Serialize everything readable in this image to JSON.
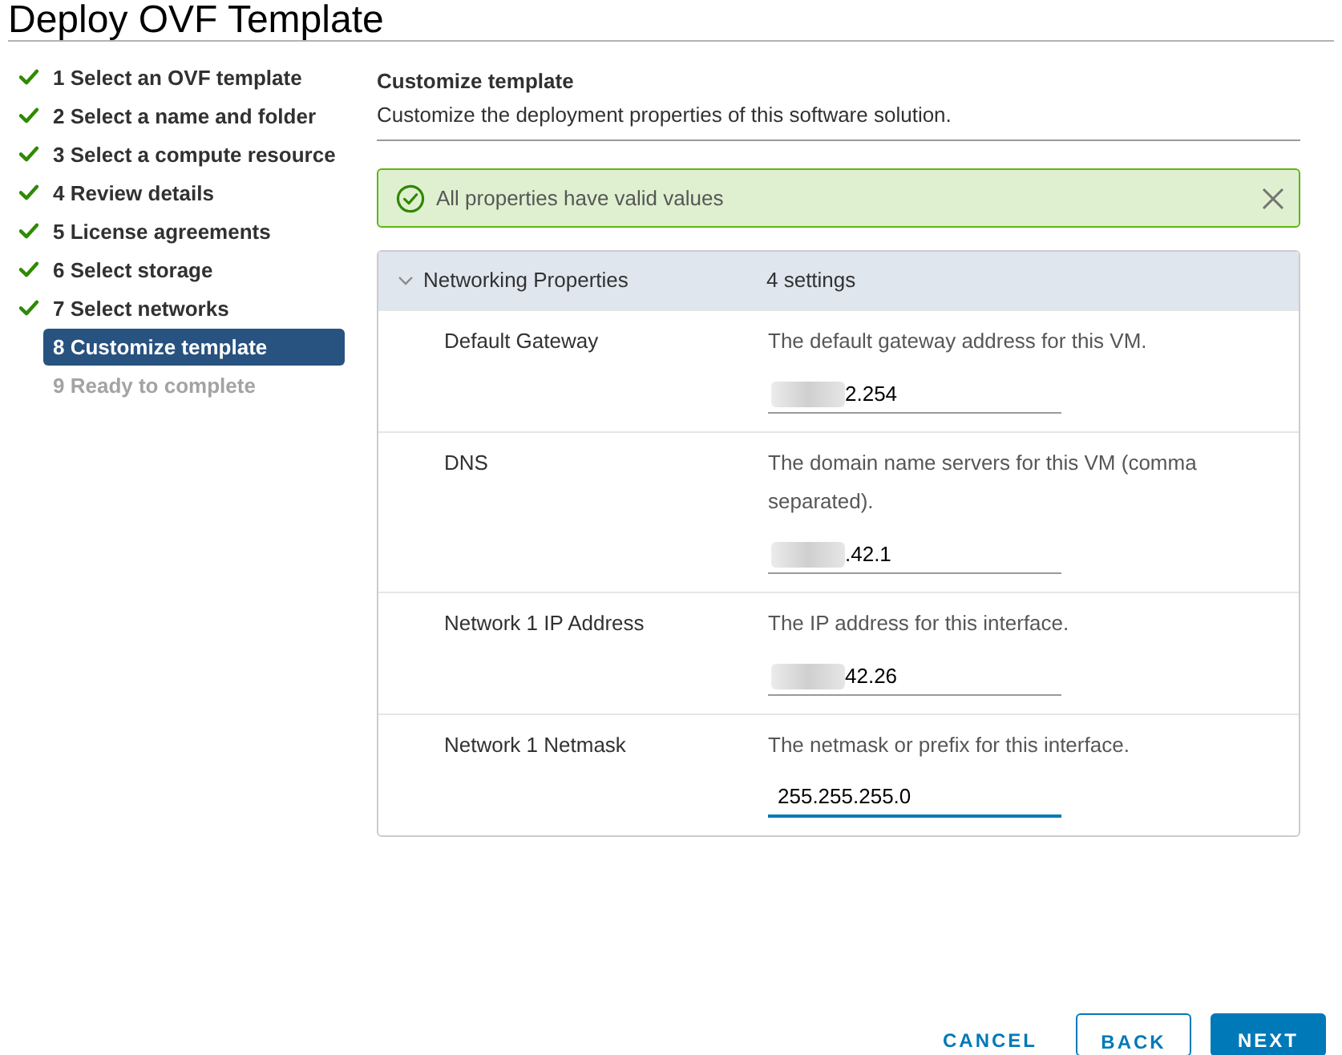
{
  "window": {
    "title": "Deploy OVF Template"
  },
  "steps": [
    {
      "label": "1 Select an OVF template",
      "completed": true,
      "selected": false,
      "disabled": false
    },
    {
      "label": "2 Select a name and folder",
      "completed": true,
      "selected": false,
      "disabled": false
    },
    {
      "label": "3 Select a compute resource",
      "completed": true,
      "selected": false,
      "disabled": false
    },
    {
      "label": "4 Review details",
      "completed": true,
      "selected": false,
      "disabled": false
    },
    {
      "label": "5 License agreements",
      "completed": true,
      "selected": false,
      "disabled": false
    },
    {
      "label": "6 Select storage",
      "completed": true,
      "selected": false,
      "disabled": false
    },
    {
      "label": "7 Select networks",
      "completed": true,
      "selected": false,
      "disabled": false
    },
    {
      "label": "8 Customize template",
      "completed": false,
      "selected": true,
      "disabled": false
    },
    {
      "label": "9 Ready to complete",
      "completed": false,
      "selected": false,
      "disabled": true
    }
  ],
  "page": {
    "title": "Customize template",
    "subtitle": "Customize the deployment properties of this software solution."
  },
  "alert": {
    "kind": "success",
    "message": "All properties have valid values",
    "dismissible": true
  },
  "property_group": {
    "title": "Networking Properties",
    "count": "4 settings",
    "expanded": true,
    "properties": [
      {
        "label": "Default Gateway",
        "description": "The default gateway address for this VM.",
        "value": "2.254",
        "redacted": true,
        "focused": false
      },
      {
        "label": "DNS",
        "description": "The domain name servers for this VM (comma separated).",
        "value": ".42.1",
        "redacted": true,
        "focused": false
      },
      {
        "label": "Network 1 IP Address",
        "description": "The IP address for this interface.",
        "value": "42.26",
        "redacted": true,
        "focused": false
      },
      {
        "label": "Network 1 Netmask",
        "description": "The netmask or prefix for this interface.",
        "value": "255.255.255.0",
        "redacted": false,
        "focused": true
      }
    ]
  },
  "buttons": [
    {
      "label": "CANCEL",
      "kind": "flat"
    },
    {
      "label": "BACK",
      "kind": "outline"
    },
    {
      "label": "NEXT",
      "kind": "primary"
    }
  ]
}
